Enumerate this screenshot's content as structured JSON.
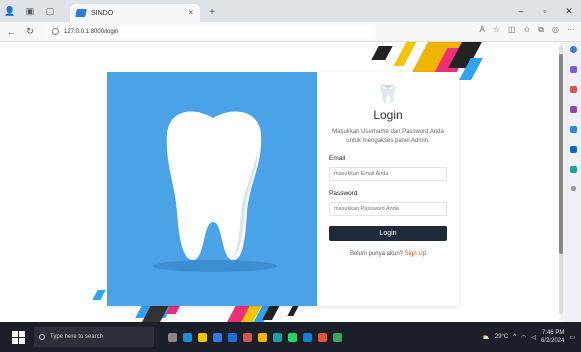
{
  "browser": {
    "tab_title": "SINDO",
    "url": "127.0.0.1:8000/login",
    "new_tab": "+",
    "tab_close": "×"
  },
  "login": {
    "logo_glyph": "🦷",
    "title": "Login",
    "description": "Masukkan Username dan Password Anda untuk mengakses panel Admin.",
    "email_label": "Email",
    "email_placeholder": "masukkan Email Anda",
    "password_label": "Password",
    "password_placeholder": "masukkan Password Anda",
    "button_label": "Login",
    "signup_prompt": "Belum punya akun?",
    "signup_link": "Sign Up"
  },
  "taskbar": {
    "search_placeholder": "Type here to search",
    "temperature": "29°C",
    "time": "7:46 PM",
    "date": "6/2/2024"
  },
  "colors": {
    "panel_blue": "#4aa3e6",
    "button_dark": "#1f2b3a",
    "link_orange": "#e64a19"
  }
}
